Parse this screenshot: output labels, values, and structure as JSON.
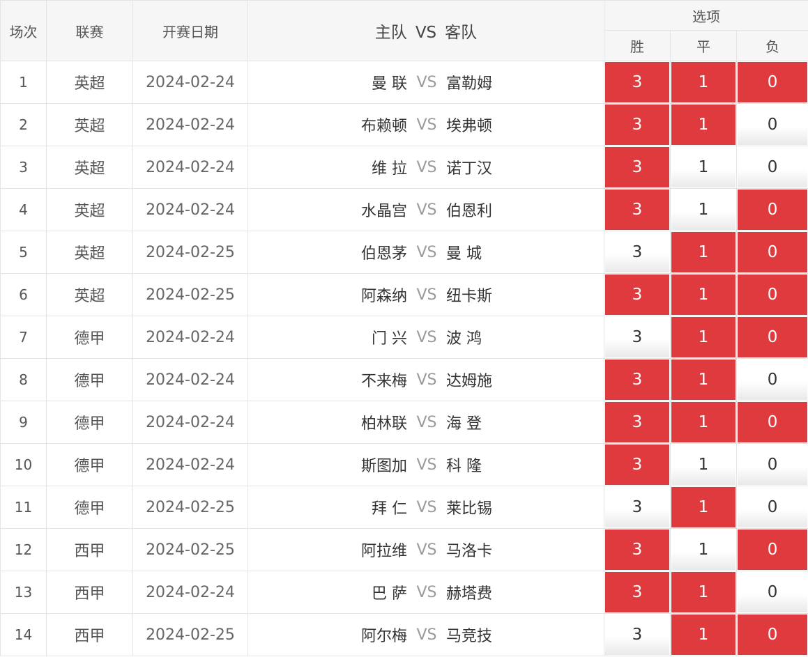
{
  "header": {
    "col_no": "场次",
    "col_league": "联赛",
    "col_date": "开赛日期",
    "col_home": "主队",
    "col_vs": "VS",
    "col_away": "客队",
    "col_options": "选项",
    "opt_win": "胜",
    "opt_draw": "平",
    "opt_lose": "负"
  },
  "colors": {
    "selected": "#df3b3f",
    "vs": "#9a9a9a"
  },
  "rows": [
    {
      "no": "1",
      "league": "英超",
      "date": "2024-02-24",
      "home": "曼 联",
      "vs": "VS",
      "away": "富勒姆",
      "win": "3",
      "draw": "1",
      "lose": "0",
      "win_sel": true,
      "draw_sel": true,
      "lose_sel": true
    },
    {
      "no": "2",
      "league": "英超",
      "date": "2024-02-24",
      "home": "布赖顿",
      "vs": "VS",
      "away": "埃弗顿",
      "win": "3",
      "draw": "1",
      "lose": "0",
      "win_sel": true,
      "draw_sel": true,
      "lose_sel": false
    },
    {
      "no": "3",
      "league": "英超",
      "date": "2024-02-24",
      "home": "维 拉",
      "vs": "VS",
      "away": "诺丁汉",
      "win": "3",
      "draw": "1",
      "lose": "0",
      "win_sel": true,
      "draw_sel": false,
      "lose_sel": false
    },
    {
      "no": "4",
      "league": "英超",
      "date": "2024-02-24",
      "home": "水晶宫",
      "vs": "VS",
      "away": "伯恩利",
      "win": "3",
      "draw": "1",
      "lose": "0",
      "win_sel": true,
      "draw_sel": false,
      "lose_sel": true
    },
    {
      "no": "5",
      "league": "英超",
      "date": "2024-02-25",
      "home": "伯恩茅",
      "vs": "VS",
      "away": "曼 城",
      "win": "3",
      "draw": "1",
      "lose": "0",
      "win_sel": false,
      "draw_sel": true,
      "lose_sel": true
    },
    {
      "no": "6",
      "league": "英超",
      "date": "2024-02-25",
      "home": "阿森纳",
      "vs": "VS",
      "away": "纽卡斯",
      "win": "3",
      "draw": "1",
      "lose": "0",
      "win_sel": true,
      "draw_sel": true,
      "lose_sel": true
    },
    {
      "no": "7",
      "league": "德甲",
      "date": "2024-02-24",
      "home": "门 兴",
      "vs": "VS",
      "away": "波 鸿",
      "win": "3",
      "draw": "1",
      "lose": "0",
      "win_sel": false,
      "draw_sel": true,
      "lose_sel": true
    },
    {
      "no": "8",
      "league": "德甲",
      "date": "2024-02-24",
      "home": "不来梅",
      "vs": "VS",
      "away": "达姆施",
      "win": "3",
      "draw": "1",
      "lose": "0",
      "win_sel": true,
      "draw_sel": true,
      "lose_sel": false
    },
    {
      "no": "9",
      "league": "德甲",
      "date": "2024-02-24",
      "home": "柏林联",
      "vs": "VS",
      "away": "海 登",
      "win": "3",
      "draw": "1",
      "lose": "0",
      "win_sel": true,
      "draw_sel": true,
      "lose_sel": true
    },
    {
      "no": "10",
      "league": "德甲",
      "date": "2024-02-24",
      "home": "斯图加",
      "vs": "VS",
      "away": "科 隆",
      "win": "3",
      "draw": "1",
      "lose": "0",
      "win_sel": true,
      "draw_sel": false,
      "lose_sel": false
    },
    {
      "no": "11",
      "league": "德甲",
      "date": "2024-02-25",
      "home": "拜 仁",
      "vs": "VS",
      "away": "莱比锡",
      "win": "3",
      "draw": "1",
      "lose": "0",
      "win_sel": false,
      "draw_sel": true,
      "lose_sel": false
    },
    {
      "no": "12",
      "league": "西甲",
      "date": "2024-02-25",
      "home": "阿拉维",
      "vs": "VS",
      "away": "马洛卡",
      "win": "3",
      "draw": "1",
      "lose": "0",
      "win_sel": true,
      "draw_sel": false,
      "lose_sel": true
    },
    {
      "no": "13",
      "league": "西甲",
      "date": "2024-02-24",
      "home": "巴 萨",
      "vs": "VS",
      "away": "赫塔费",
      "win": "3",
      "draw": "1",
      "lose": "0",
      "win_sel": true,
      "draw_sel": true,
      "lose_sel": false
    },
    {
      "no": "14",
      "league": "西甲",
      "date": "2024-02-25",
      "home": "阿尔梅",
      "vs": "VS",
      "away": "马竞技",
      "win": "3",
      "draw": "1",
      "lose": "0",
      "win_sel": false,
      "draw_sel": true,
      "lose_sel": true
    }
  ]
}
